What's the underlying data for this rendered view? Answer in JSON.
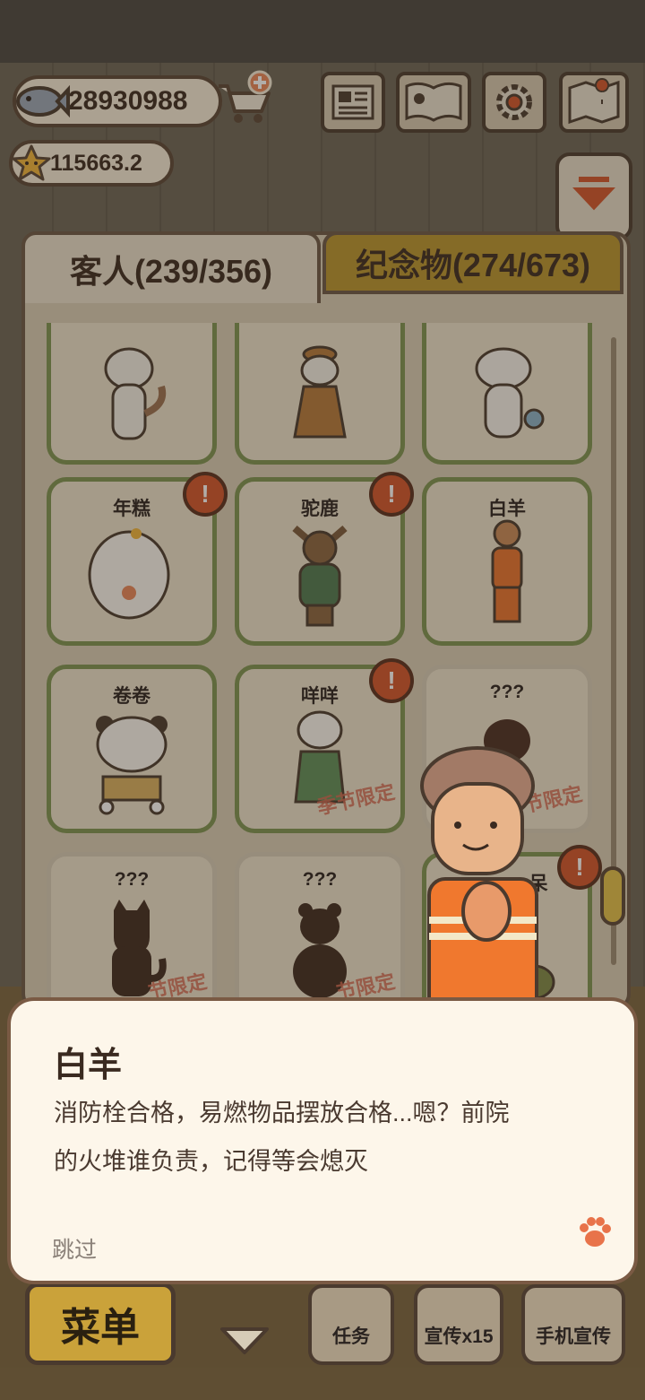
{
  "hud": {
    "coins": "28930988",
    "stars": "115663.2"
  },
  "tabs": {
    "guests": "客人(239/356)",
    "souvenirs": "纪念物(274/673)"
  },
  "cards": [
    {
      "name": "",
      "partial": true
    },
    {
      "name": "",
      "partial": true
    },
    {
      "name": "",
      "partial": true
    },
    {
      "name": "年糕",
      "alert": true
    },
    {
      "name": "驼鹿",
      "alert": true
    },
    {
      "name": "白羊"
    },
    {
      "name": "卷卷"
    },
    {
      "name": "咩咩",
      "alert": true,
      "tag": "季节限定"
    },
    {
      "name": "???",
      "tag": "节限定",
      "locked": true
    },
    {
      "name": "???",
      "locked": true,
      "tag": "节限定"
    },
    {
      "name": "???",
      "locked": true,
      "tag": "节限定"
    },
    {
      "name": "呆",
      "alert": true
    }
  ],
  "bottom": {
    "menu": "菜单",
    "task": "任务",
    "promo": "宣传x15",
    "phone_promo": "手机宣传"
  },
  "dialog": {
    "speaker": "白羊",
    "text_line1": "消防栓合格，易燃物品摆放合格...嗯？前院",
    "text_line2": "的火堆谁负责，记得等会熄灭",
    "skip": "跳过"
  },
  "colors": {
    "card_border": "#7c9452",
    "alert_badge": "#d2542a",
    "souvenir_tab": "#b8952e",
    "dialog_bg": "#fdf6ea"
  }
}
